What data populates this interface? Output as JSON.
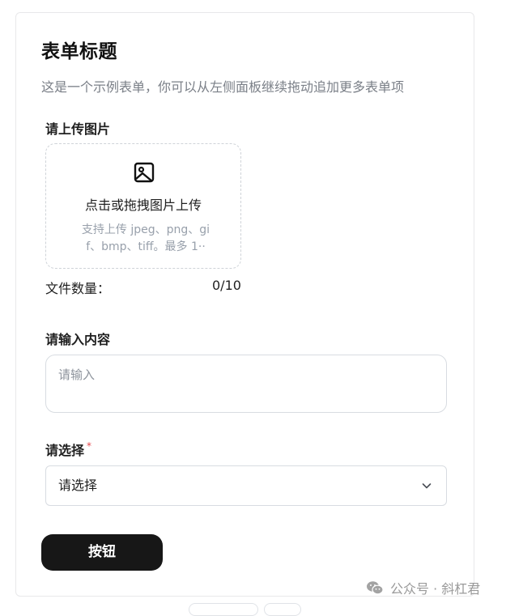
{
  "form": {
    "title": "表单标题",
    "description": "这是一个示例表单，你可以从左侧面板继续拖动追加更多表单项"
  },
  "upload": {
    "label": "请上传图片",
    "icon": "image-icon",
    "prompt": "点击或拖拽图片上传",
    "hint": "支持上传 jpeg、png、gif、bmp、tiff。最多 1··",
    "count_label": "文件数量：",
    "count_value": "0/10"
  },
  "text_input": {
    "label": "请输入内容",
    "placeholder": "请输入"
  },
  "select": {
    "label": "请选择",
    "required": "*",
    "selected": "请选择",
    "icon": "chevron-down-icon"
  },
  "submit": {
    "label": "按钮"
  },
  "watermark": {
    "icon": "wechat-icon",
    "text": "公众号 · 斜杠君"
  }
}
